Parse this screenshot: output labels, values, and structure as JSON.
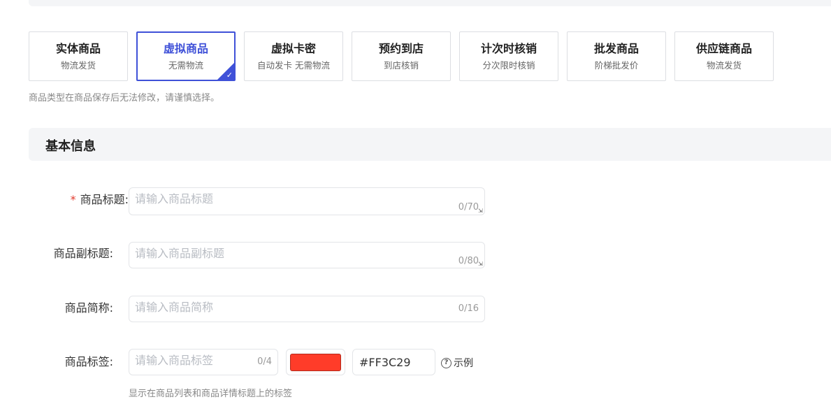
{
  "product_types": [
    {
      "title": "实体商品",
      "subtitle": "物流发货",
      "selected": false
    },
    {
      "title": "虚拟商品",
      "subtitle": "无需物流",
      "selected": true
    },
    {
      "title": "虚拟卡密",
      "subtitle": "自动发卡 无需物流",
      "selected": false
    },
    {
      "title": "预约到店",
      "subtitle": "到店核销",
      "selected": false
    },
    {
      "title": "计次时核销",
      "subtitle": "分次限时核销",
      "selected": false
    },
    {
      "title": "批发商品",
      "subtitle": "阶梯批发价",
      "selected": false
    },
    {
      "title": "供应链商品",
      "subtitle": "物流发货",
      "selected": false
    }
  ],
  "type_tip": "商品类型在商品保存后无法修改，请谨慎选择。",
  "section": {
    "title": "基本信息"
  },
  "form": {
    "title": {
      "required_mark": "*",
      "label": "商品标题:",
      "placeholder": "请输入商品标题",
      "counter": "0/70"
    },
    "subtitle": {
      "label": "商品副标题:",
      "placeholder": "请输入商品副标题",
      "counter": "0/80"
    },
    "short_name": {
      "label": "商品简称:",
      "placeholder": "请输入商品简称",
      "counter": "0/16"
    },
    "tag": {
      "label": "商品标签:",
      "placeholder": "请输入商品标签",
      "counter": "0/4",
      "color": "#FF3C29",
      "color_hex_text": "#FF3C29",
      "example_label": "示例",
      "example_icon": "question-circle-icon",
      "help_text": "显示在商品列表和商品详情标题上的标签"
    }
  },
  "colors": {
    "accent": "#3f51d8",
    "required": "#e23b2e"
  }
}
